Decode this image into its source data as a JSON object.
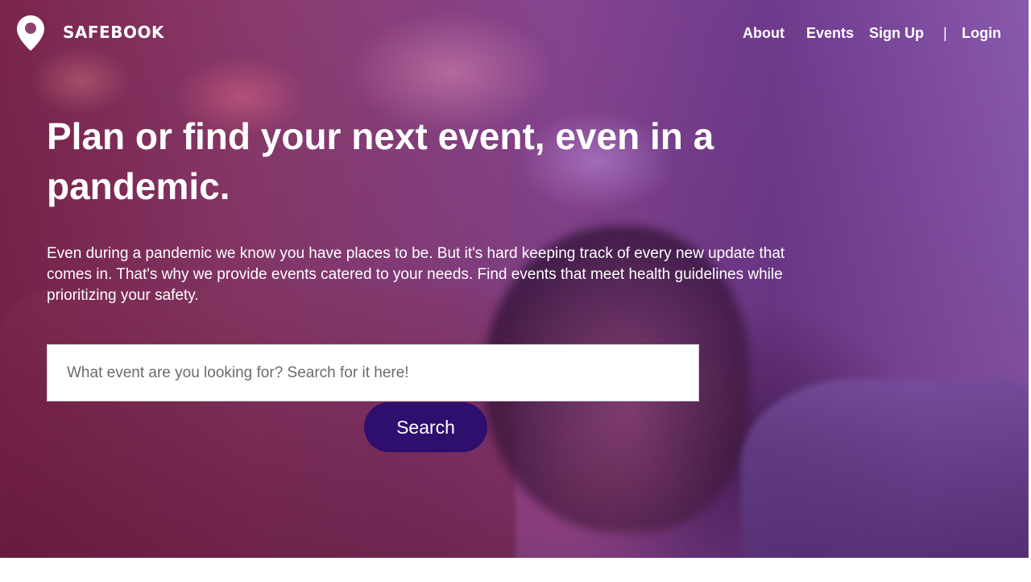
{
  "brand": {
    "name": "SAFEBOOK",
    "icon": "map-pin-icon"
  },
  "nav": {
    "items": [
      {
        "label": "About"
      },
      {
        "label": "Events"
      },
      {
        "label": "Sign Up"
      },
      {
        "label": "Login"
      }
    ],
    "separator": "|"
  },
  "hero": {
    "headline": "Plan or find your next event, even in a pandemic.",
    "description": "Even during a pandemic we know you have places to be. But it's hard keeping track of every new update that comes in. That's why we provide events catered to your needs. Find events that meet health guidelines while prioritizing your safety.",
    "search": {
      "placeholder": "What event are you looking for? Search for it here!",
      "value": "",
      "button_label": "Search"
    }
  },
  "colors": {
    "button_background": "#2e0f6e",
    "text": "#ffffff",
    "hero_tint": "#87468e"
  }
}
